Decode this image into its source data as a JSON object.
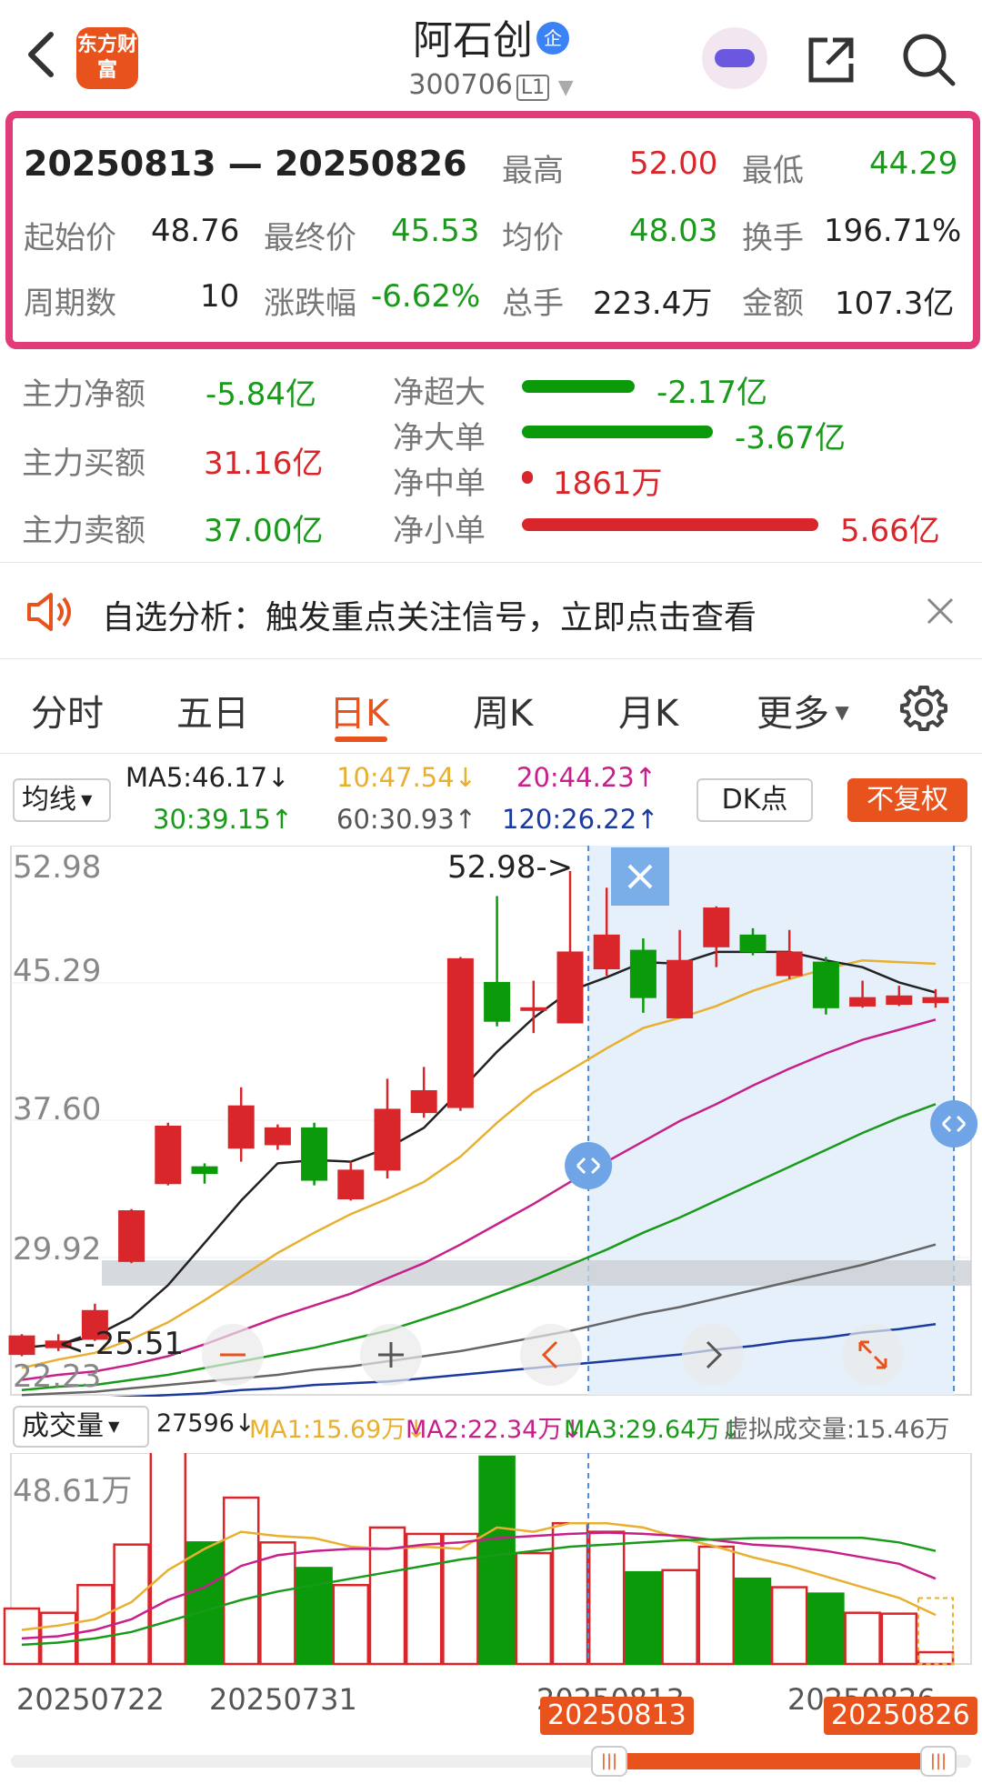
{
  "header": {
    "back_label": "<",
    "logo_text": "东方财富",
    "stock_name": "阿石创",
    "enterprise_badge": "企",
    "stock_code": "300706",
    "level": "L1"
  },
  "period": {
    "range": "20250813 — 20250826",
    "high_label": "最高",
    "high": "52.00",
    "low_label": "最低",
    "low": "44.29",
    "open_label": "起始价",
    "open": "48.76",
    "close_label": "最终价",
    "close": "45.53",
    "avg_label": "均价",
    "avg": "48.03",
    "turnover_label": "换手",
    "turnover": "196.71%",
    "count_label": "周期数",
    "count": "10",
    "change_label": "涨跌幅",
    "change": "-6.62%",
    "volume_label": "总手",
    "volume": "223.4万",
    "amount_label": "金额",
    "amount": "107.3亿"
  },
  "money_flow": {
    "net_label": "主力净额",
    "net": "-5.84亿",
    "buy_label": "主力买额",
    "buy": "31.16亿",
    "sell_label": "主力卖额",
    "sell": "37.00亿",
    "items": [
      {
        "label": "净超大",
        "value": "-2.17亿"
      },
      {
        "label": "净大单",
        "value": "-3.67亿"
      },
      {
        "label": "净中单",
        "value": "1861万"
      },
      {
        "label": "净小单",
        "value": "5.66亿"
      }
    ]
  },
  "notice": {
    "text": "自选分析：触发重点关注信号，立即点击查看"
  },
  "tabs": [
    "分时",
    "五日",
    "日K",
    "周K",
    "月K",
    "更多"
  ],
  "active_tab": "日K",
  "ma_bar": {
    "selector": "均线",
    "ma5": "MA5:46.17↓",
    "ma10": "10:47.54↓",
    "ma20": "20:44.23↑",
    "ma30": "30:39.15↑",
    "ma60": "60:30.93↑",
    "ma120": "120:26.22↑",
    "dk_label": "DK点",
    "fq_label": "不复权"
  },
  "colors": {
    "up": "#d9262b",
    "down": "#0a9a0a",
    "ma5": "#222222",
    "ma10": "#e8b030",
    "ma20": "#c7208a",
    "ma30": "#1a9a1a",
    "ma60": "#666666",
    "ma120": "#1a3aa0",
    "accent": "#e8531d"
  },
  "price_axis": [
    "52.98",
    "45.29",
    "37.60",
    "29.92",
    "22.23"
  ],
  "annotations": {
    "high_marker": "52.98->",
    "low_marker": "<-25.51"
  },
  "volume": {
    "selector": "成交量",
    "current": "27596↓",
    "ma1": "MA1:15.69万↓",
    "ma2": "MA2:22.34万↓",
    "ma3": "MA3:29.64万↓",
    "virtual": "虚拟成交量:15.46万",
    "axis_max": "48.61万"
  },
  "dates": {
    "d1": "20250722",
    "d2": "20250731",
    "d3": "20250813",
    "d4": "20250826",
    "range_start": "20250813",
    "range_end": "20250826"
  },
  "chart_data": {
    "type": "candlestick",
    "ylim": [
      22.23,
      52.98
    ],
    "candles": [
      {
        "o": 24.4,
        "c": 25.5,
        "h": 25.6,
        "l": 24.3
      },
      {
        "o": 24.8,
        "c": 25.2,
        "h": 25.6,
        "l": 24.6
      },
      {
        "o": 25.3,
        "c": 27.0,
        "h": 27.4,
        "l": 25.2
      },
      {
        "o": 29.9,
        "c": 32.9,
        "h": 33.0,
        "l": 29.8
      },
      {
        "o": 34.5,
        "c": 37.9,
        "h": 38.1,
        "l": 34.4
      },
      {
        "o": 35.5,
        "c": 35.1,
        "h": 35.7,
        "l": 34.5
      },
      {
        "o": 36.6,
        "c": 39.1,
        "h": 40.2,
        "l": 35.8
      },
      {
        "o": 36.8,
        "c": 37.8,
        "h": 38.0,
        "l": 36.5
      },
      {
        "o": 37.8,
        "c": 34.7,
        "h": 38.1,
        "l": 34.4
      },
      {
        "o": 33.6,
        "c": 35.3,
        "h": 35.8,
        "l": 33.5
      },
      {
        "o": 35.3,
        "c": 38.9,
        "h": 40.7,
        "l": 34.8
      },
      {
        "o": 38.7,
        "c": 40.0,
        "h": 41.4,
        "l": 38.4
      },
      {
        "o": 39.0,
        "c": 47.8,
        "h": 47.9,
        "l": 38.8
      },
      {
        "o": 46.4,
        "c": 44.1,
        "h": 51.5,
        "l": 43.8
      },
      {
        "o": 44.9,
        "c": 44.9,
        "h": 46.5,
        "l": 43.4
      },
      {
        "o": 44.0,
        "c": 48.2,
        "h": 52.98,
        "l": 44.0
      },
      {
        "o": 47.2,
        "c": 49.2,
        "h": 52.0,
        "l": 46.8
      },
      {
        "o": 48.3,
        "c": 45.5,
        "h": 49.0,
        "l": 44.6
      },
      {
        "o": 44.3,
        "c": 47.7,
        "h": 49.5,
        "l": 44.29
      },
      {
        "o": 48.5,
        "c": 50.8,
        "h": 50.9,
        "l": 47.3
      },
      {
        "o": 49.2,
        "c": 48.2,
        "h": 49.6,
        "l": 48.0
      },
      {
        "o": 46.8,
        "c": 48.2,
        "h": 49.5,
        "l": 46.6
      },
      {
        "o": 47.6,
        "c": 44.9,
        "h": 47.9,
        "l": 44.5
      },
      {
        "o": 45.0,
        "c": 45.5,
        "h": 46.5,
        "l": 44.9
      },
      {
        "o": 45.1,
        "c": 45.6,
        "h": 46.2,
        "l": 45.0
      },
      {
        "o": 45.2,
        "c": 45.5,
        "h": 46.0,
        "l": 44.9
      }
    ],
    "ma5": [
      24.8,
      25.0,
      25.5,
      26.6,
      28.5,
      31.0,
      33.5,
      35.7,
      35.9,
      35.8,
      36.6,
      37.8,
      40.0,
      42.3,
      44.3,
      45.9,
      46.7,
      47.6,
      47.5,
      48.2,
      48.2,
      48.2,
      47.7,
      47.3,
      46.4,
      45.8
    ],
    "ma10": [
      23.6,
      24.1,
      24.5,
      25.3,
      26.3,
      27.6,
      29.0,
      30.4,
      31.6,
      32.7,
      33.6,
      34.6,
      36.1,
      38.1,
      39.9,
      41.2,
      42.5,
      43.7,
      44.3,
      45.0,
      45.9,
      46.6,
      47.2,
      47.7,
      47.6,
      47.5
    ],
    "ma20": [
      22.9,
      23.2,
      23.4,
      23.8,
      24.3,
      25.0,
      25.8,
      26.6,
      27.3,
      28.0,
      28.9,
      29.8,
      30.9,
      32.1,
      33.3,
      34.6,
      35.8,
      37.0,
      38.2,
      39.2,
      40.3,
      41.3,
      42.2,
      43.0,
      43.6,
      44.2
    ],
    "ma30": [
      22.3,
      22.5,
      22.6,
      22.9,
      23.2,
      23.6,
      24.0,
      24.4,
      24.8,
      25.3,
      25.8,
      26.5,
      27.2,
      28.0,
      28.8,
      29.7,
      30.6,
      31.6,
      32.5,
      33.5,
      34.5,
      35.5,
      36.5,
      37.5,
      38.4,
      39.2
    ],
    "ma60": [
      22.0,
      22.1,
      22.2,
      22.4,
      22.6,
      22.8,
      23.0,
      23.2,
      23.5,
      23.7,
      24.0,
      24.3,
      24.6,
      25.0,
      25.4,
      25.8,
      26.3,
      26.8,
      27.2,
      27.7,
      28.2,
      28.7,
      29.2,
      29.7,
      30.3,
      30.9
    ],
    "ma120": [
      21.6,
      21.7,
      21.8,
      21.9,
      22.0,
      22.1,
      22.3,
      22.4,
      22.6,
      22.7,
      22.8,
      23.0,
      23.2,
      23.4,
      23.6,
      23.8,
      24.0,
      24.2,
      24.4,
      24.7,
      24.9,
      25.2,
      25.4,
      25.7,
      25.9,
      26.2
    ],
    "volumes": [
      13.0,
      12.0,
      18.5,
      28.0,
      50.0,
      28.5,
      39.0,
      28.5,
      22.5,
      18.5,
      32.0,
      30.5,
      30.5,
      48.61,
      26.0,
      33.0,
      31.0,
      21.5,
      22.0,
      27.5,
      20.0,
      18.0,
      16.5,
      12.0,
      11.8,
      2.76
    ],
    "vol_ma1": [
      8.0,
      9.0,
      10.5,
      14.5,
      22.0,
      27.0,
      31.0,
      30.0,
      29.5,
      27.5,
      27.0,
      27.5,
      27.0,
      32.0,
      31.0,
      33.0,
      33.0,
      32.0,
      29.5,
      27.5,
      25.0,
      23.0,
      20.5,
      18.0,
      15.5,
      11.5
    ],
    "vol_ma2": [
      6.0,
      6.5,
      8.0,
      10.5,
      15.0,
      18.0,
      23.0,
      25.5,
      26.5,
      27.0,
      27.0,
      28.0,
      28.5,
      29.5,
      30.0,
      30.5,
      30.8,
      30.5,
      30.0,
      29.0,
      28.0,
      27.5,
      26.5,
      25.0,
      23.5,
      20.0
    ],
    "vol_ma3": [
      4.5,
      5.0,
      6.0,
      7.5,
      10.0,
      12.5,
      15.0,
      17.0,
      18.5,
      20.0,
      21.5,
      23.0,
      24.5,
      25.5,
      26.5,
      27.5,
      28.0,
      28.5,
      29.0,
      29.2,
      29.5,
      29.6,
      29.6,
      29.6,
      28.5,
      26.5
    ],
    "vol_ylim": [
      0,
      48.61
    ],
    "selection": {
      "start_index": 16,
      "end_index": 25
    }
  }
}
